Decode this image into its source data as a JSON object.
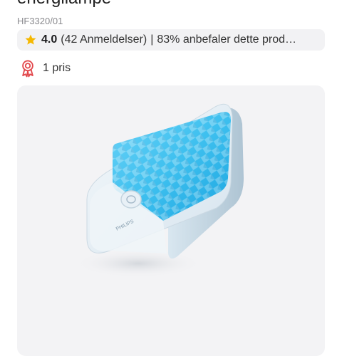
{
  "product": {
    "title": "energilampe",
    "sku": "HF3320/01"
  },
  "rating": {
    "icon": "star-icon",
    "score": "4.0",
    "reviews": "(42 Anmeldelser)",
    "separator": "|",
    "recommend": "83% anbefaler dette prod…"
  },
  "prices": {
    "icon": "award-ribbon-icon",
    "label": "1 pris"
  },
  "image": {
    "alt": "Philips energilampe",
    "brand_text": "PHILIPS"
  },
  "colors": {
    "star": "#f5b800",
    "ribbon": "#e2474b",
    "panel_blue": "#3ec0ef",
    "card_bg": "#f3f3f5"
  }
}
